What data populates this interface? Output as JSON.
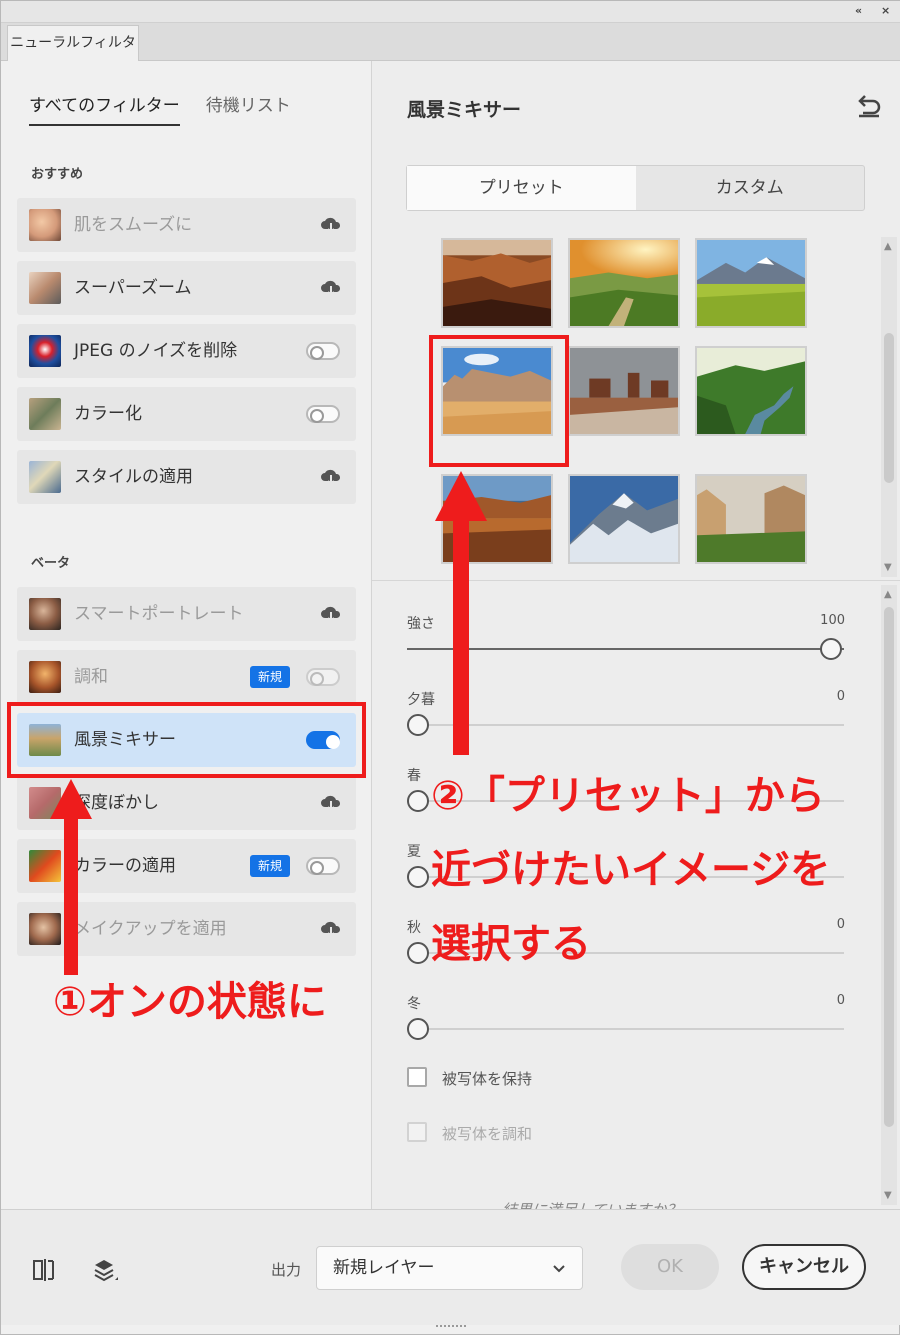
{
  "window": {
    "collapse": "«",
    "close": "×",
    "panel_tab": "ニューラルフィルター"
  },
  "filter_tabs": [
    "すべてのフィルター",
    "待機リスト"
  ],
  "sections": {
    "recommended": "おすすめ",
    "beta": "ベータ"
  },
  "recommended_items": [
    {
      "label": "肌をスムーズに",
      "control": "download",
      "dim": true
    },
    {
      "label": "スーパーズーム",
      "control": "download",
      "dim": false
    },
    {
      "label": "JPEG のノイズを削除",
      "control": "toggle-off",
      "dim": false
    },
    {
      "label": "カラー化",
      "control": "toggle-off",
      "dim": false
    },
    {
      "label": "スタイルの適用",
      "control": "download",
      "dim": false
    }
  ],
  "beta_items": [
    {
      "label": "スマートポートレート",
      "control": "download",
      "dim": true
    },
    {
      "label": "調和",
      "control": "toggle-off",
      "badge": "新規",
      "dim": true
    },
    {
      "label": "風景ミキサー",
      "control": "toggle-on",
      "selected": true,
      "dim": false
    },
    {
      "label": "深度ぼかし",
      "control": "download",
      "dim": false
    },
    {
      "label": "カラーの適用",
      "control": "toggle-off",
      "badge": "新規",
      "dim": false
    },
    {
      "label": "メイクアップを適用",
      "control": "download",
      "dim": true
    }
  ],
  "panel": {
    "title": "風景ミキサー",
    "segments": [
      "プリセット",
      "カスタム"
    ],
    "active_segment": "プリセット"
  },
  "presets": [
    "canyon",
    "sunrise-meadow",
    "mountain-meadow",
    "desert-cliffs",
    "monument-valley",
    "river-valley",
    "lake-reflection",
    "snowy-peaks",
    "yosemite-valley"
  ],
  "selected_preset": "desert-cliffs",
  "sliders": [
    {
      "label": "強さ",
      "value": 100,
      "value_text": "100"
    },
    {
      "label": "夕暮",
      "value": 0,
      "value_text": "0"
    },
    {
      "label": "春",
      "value": 0,
      "value_text": ""
    },
    {
      "label": "夏",
      "value": 0,
      "value_text": ""
    },
    {
      "label": "秋",
      "value": 0,
      "value_text": "0"
    },
    {
      "label": "冬",
      "value": 0,
      "value_text": "0"
    }
  ],
  "checkboxes": [
    {
      "label": "被写体を保持",
      "checked": false,
      "enabled": true
    },
    {
      "label": "被写体を調和",
      "checked": false,
      "enabled": false
    }
  ],
  "feedback_text": "結果に満足していますか？",
  "bottom": {
    "output_label": "出力",
    "output_value": "新規レイヤー",
    "ok": "OK",
    "cancel": "キャンセル"
  },
  "annotations": {
    "step1": "①オンの状態に",
    "step2_line1": "②「プリセット」から",
    "step2_line2": "近づけたいイメージを",
    "step2_line3": "選択する",
    "color": "#ee1c1c"
  }
}
